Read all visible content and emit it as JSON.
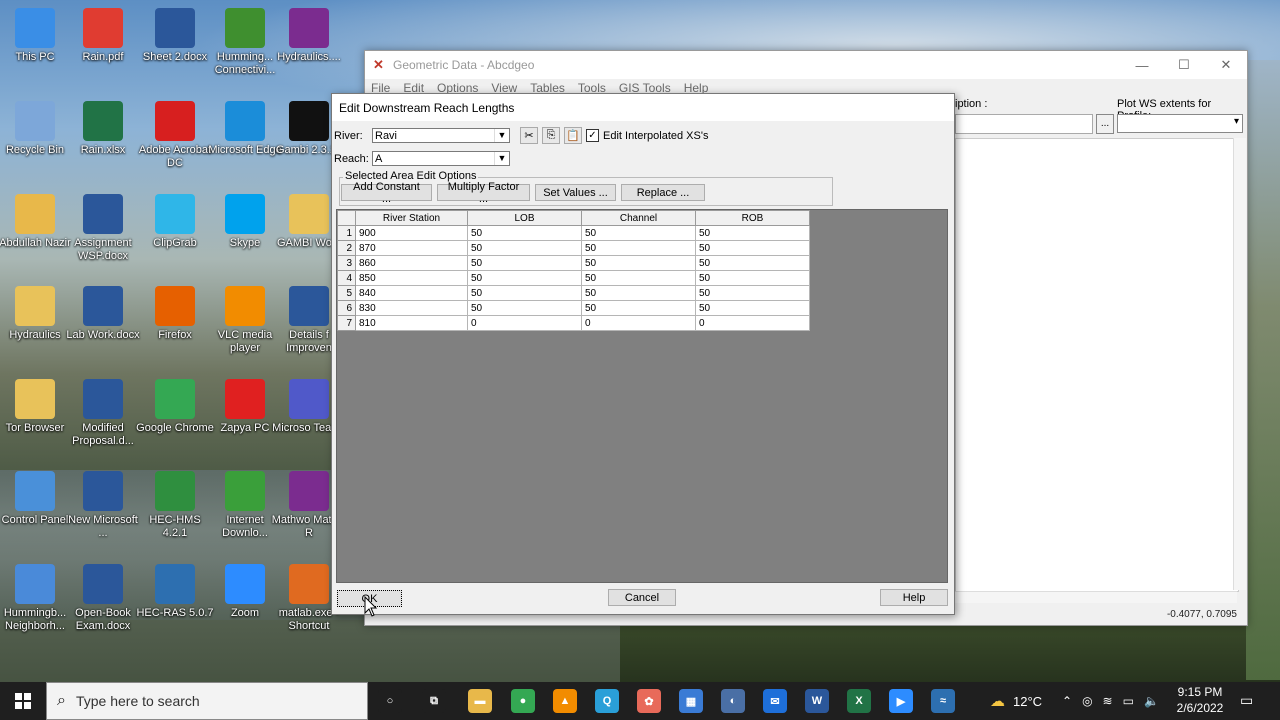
{
  "desktop": {
    "icons": [
      {
        "label": "This PC",
        "icon": "computer-icon",
        "color": "#3a8ee6"
      },
      {
        "label": "Rain.pdf",
        "icon": "pdf-icon",
        "color": "#e03c31"
      },
      {
        "label": "Sheet 2.docx",
        "icon": "word-icon",
        "color": "#2b579a"
      },
      {
        "label": "Humming... Connectivi...",
        "icon": "hummingbird-icon",
        "color": "#3f8f2f"
      },
      {
        "label": "Hydraulics....",
        "icon": "winrar-icon",
        "color": "#7b2c8f"
      },
      {
        "label": "Recycle Bin",
        "icon": "recycle-bin-icon",
        "color": "#7da7d9"
      },
      {
        "label": "Rain.xlsx",
        "icon": "excel-icon",
        "color": "#217346"
      },
      {
        "label": "Adobe Acrobat DC",
        "icon": "acrobat-icon",
        "color": "#d71f1f"
      },
      {
        "label": "Microsoft Edge",
        "icon": "edge-icon",
        "color": "#1b8dd9"
      },
      {
        "label": "Gambi 2.3.16",
        "icon": "gambit-icon",
        "color": "#111111"
      },
      {
        "label": "Abdullah Nazir",
        "icon": "user-folder-icon",
        "color": "#e8b84a"
      },
      {
        "label": "Assignment WSP.docx",
        "icon": "word-icon",
        "color": "#2b579a"
      },
      {
        "label": "ClipGrab",
        "icon": "clipgrab-icon",
        "color": "#2fb6e8"
      },
      {
        "label": "Skype",
        "icon": "skype-icon",
        "color": "#00a2ed"
      },
      {
        "label": "GAMBI Work",
        "icon": "folder-icon",
        "color": "#e8c25a"
      },
      {
        "label": "Hydraulics",
        "icon": "folder-icon",
        "color": "#e8c25a"
      },
      {
        "label": "Lab Work.docx",
        "icon": "word-icon",
        "color": "#2b579a"
      },
      {
        "label": "Firefox",
        "icon": "firefox-icon",
        "color": "#e66000"
      },
      {
        "label": "VLC media player",
        "icon": "vlc-icon",
        "color": "#f28c00"
      },
      {
        "label": "Details f Improven",
        "icon": "word-icon",
        "color": "#2b579a"
      },
      {
        "label": "Tor Browser",
        "icon": "folder-icon",
        "color": "#e8c25a"
      },
      {
        "label": "Modified Proposal.d...",
        "icon": "word-icon",
        "color": "#2b579a"
      },
      {
        "label": "Google Chrome",
        "icon": "chrome-icon",
        "color": "#34a853"
      },
      {
        "label": "Zapya PC",
        "icon": "zapya-icon",
        "color": "#e02020"
      },
      {
        "label": "Microso Teams",
        "icon": "teams-icon",
        "color": "#5059c9"
      },
      {
        "label": "Control Panel",
        "icon": "control-panel-icon",
        "color": "#4a90d9"
      },
      {
        "label": "New Microsoft ...",
        "icon": "word-icon",
        "color": "#2b579a"
      },
      {
        "label": "HEC-HMS 4.2.1",
        "icon": "hec-hms-icon",
        "color": "#2f8f3f"
      },
      {
        "label": "Internet Downlo...",
        "icon": "idm-icon",
        "color": "#3a9f3a"
      },
      {
        "label": "Mathwo Matlab R",
        "icon": "winrar-icon",
        "color": "#7b2c8f"
      },
      {
        "label": "Hummingb... Neighborh...",
        "icon": "network-icon",
        "color": "#4a8ad9"
      },
      {
        "label": "Open-Book Exam.docx",
        "icon": "word-icon",
        "color": "#2b579a"
      },
      {
        "label": "HEC-RAS 5.0.7",
        "icon": "hec-ras-icon",
        "color": "#2d6fb0"
      },
      {
        "label": "Zoom",
        "icon": "zoom-icon",
        "color": "#2d8cff"
      },
      {
        "label": "matlab.exe - Shortcut",
        "icon": "matlab-icon",
        "color": "#e06a20"
      }
    ]
  },
  "geo_window": {
    "title": "Geometric Data - Abcdgeo",
    "menu": [
      "File",
      "Edit",
      "Options",
      "View",
      "Tables",
      "Tools",
      "GIS Tools",
      "Help"
    ],
    "description_label": "iption :",
    "plot_ws_label": "Plot WS extents for Profile:",
    "dots_label": "...",
    "coords": "-0.4077, 0.7095"
  },
  "dialog": {
    "title": "Edit Downstream Reach Lengths",
    "river_label": "River:",
    "river_value": "Ravi",
    "reach_label": "Reach:",
    "reach_value": "A",
    "edit_interp_label": "Edit Interpolated XS's",
    "group_title": "Selected Area Edit Options",
    "buttons": {
      "add_constant": "Add Constant ...",
      "multiply_factor": "Multiply Factor ...",
      "set_values": "Set Values ...",
      "replace": "Replace ...",
      "ok": "OK",
      "cancel": "Cancel",
      "help": "Help"
    },
    "columns": [
      "River Station",
      "LOB",
      "Channel",
      "ROB"
    ],
    "rows": [
      {
        "n": "1",
        "station": "900",
        "lob": "50",
        "channel": "50",
        "rob": "50"
      },
      {
        "n": "2",
        "station": "870",
        "lob": "50",
        "channel": "50",
        "rob": "50"
      },
      {
        "n": "3",
        "station": "860",
        "lob": "50",
        "channel": "50",
        "rob": "50"
      },
      {
        "n": "4",
        "station": "850",
        "lob": "50",
        "channel": "50",
        "rob": "50"
      },
      {
        "n": "5",
        "station": "840",
        "lob": "50",
        "channel": "50",
        "rob": "50"
      },
      {
        "n": "6",
        "station": "830",
        "lob": "50",
        "channel": "50",
        "rob": "50"
      },
      {
        "n": "7",
        "station": "810",
        "lob": "0",
        "channel": "0",
        "rob": "0"
      }
    ]
  },
  "taskbar": {
    "search_placeholder": "Type here to search",
    "temperature": "12°C",
    "time": "9:15 PM",
    "date": "2/6/2022",
    "apps": [
      {
        "name": "task-view-icon",
        "color": "#1f1f1f",
        "glyph": "○"
      },
      {
        "name": "timeline-icon",
        "color": "#1f1f1f",
        "glyph": "⧉"
      },
      {
        "name": "file-explorer-icon",
        "color": "#e8b84a",
        "glyph": "▬"
      },
      {
        "name": "chrome-icon",
        "color": "#34a853",
        "glyph": "●"
      },
      {
        "name": "vlc-icon",
        "color": "#f28c00",
        "glyph": "▲"
      },
      {
        "name": "search-app-icon",
        "color": "#2a9fd8",
        "glyph": "Q"
      },
      {
        "name": "paint-icon",
        "color": "#e86a5a",
        "glyph": "✿"
      },
      {
        "name": "store-icon",
        "color": "#3a7bd5",
        "glyph": "▦"
      },
      {
        "name": "remote-icon",
        "color": "#4a6fa5",
        "glyph": "◐"
      },
      {
        "name": "mail-icon",
        "color": "#1e6fd9",
        "glyph": "✉"
      },
      {
        "name": "word-icon",
        "color": "#2b579a",
        "glyph": "W"
      },
      {
        "name": "excel-icon",
        "color": "#217346",
        "glyph": "X"
      },
      {
        "name": "zoom-icon",
        "color": "#2d8cff",
        "glyph": "▶"
      },
      {
        "name": "hec-ras-icon",
        "color": "#2d6fb0",
        "glyph": "≈"
      }
    ]
  }
}
